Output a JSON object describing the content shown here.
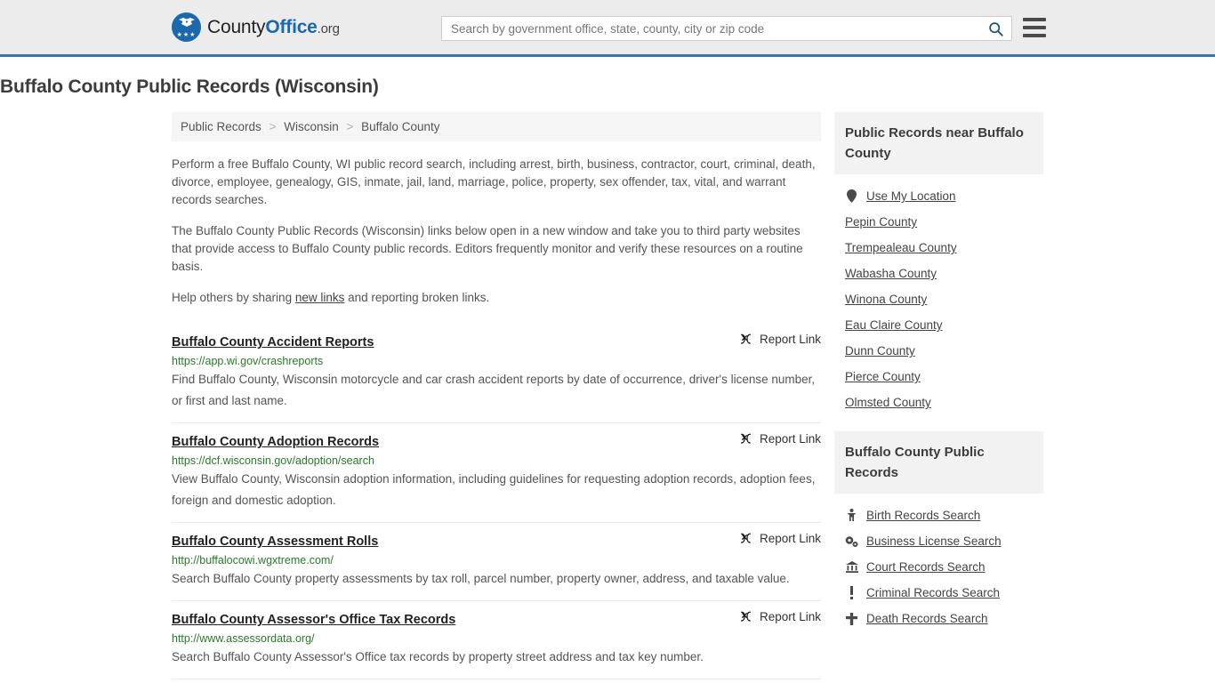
{
  "header": {
    "logo": {
      "prefix": "County",
      "bold": "Office",
      "tld": ".org",
      "icon": "eagle-logo-icon",
      "stars": "★★★"
    },
    "search": {
      "placeholder": "Search by government office, state, county, city or zip code",
      "value": "",
      "button_icon": "search-icon"
    },
    "menu_icon": "hamburger-menu-icon",
    "accent_color": "#3a74a8"
  },
  "page": {
    "title": "Buffalo County Public Records (Wisconsin)"
  },
  "breadcrumb": {
    "items": [
      "Public Records",
      "Wisconsin",
      "Buffalo County"
    ],
    "separator": ">"
  },
  "intro": {
    "p1": "Perform a free Buffalo County, WI public record search, including arrest, birth, business, contractor, court, criminal, death, divorce, employee, genealogy, GIS, inmate, jail, land, marriage, police, property, sex offender, tax, vital, and warrant records searches.",
    "p2": "The Buffalo County Public Records (Wisconsin) links below open in a new window and take you to third party websites that provide access to Buffalo County public records. Editors frequently monitor and verify these resources on a routine basis.",
    "p3_before": "Help others by sharing ",
    "p3_link": "new links",
    "p3_after": " and reporting broken links."
  },
  "report_link_label": "Report Link",
  "report_link_icon": "broken-link-icon",
  "listings": [
    {
      "title": "Buffalo County Accident Reports",
      "url": "https://app.wi.gov/crashreports",
      "description": "Find Buffalo County, Wisconsin motorcycle and car crash accident reports by date of occurrence, driver's license number, or first and last name."
    },
    {
      "title": "Buffalo County Adoption Records",
      "url": "https://dcf.wisconsin.gov/adoption/search",
      "description": "View Buffalo County, Wisconsin adoption information, including guidelines for requesting adoption records, adoption fees, foreign and domestic adoption."
    },
    {
      "title": "Buffalo County Assessment Rolls",
      "url": "http://buffalocowi.wgxtreme.com/",
      "description": "Search Buffalo County property assessments by tax roll, parcel number, property owner, address, and taxable value."
    },
    {
      "title": "Buffalo County Assessor's Office Tax Records",
      "url": "http://www.assessordata.org/",
      "description": "Search Buffalo County Assessor's Office tax records by property street address and tax key number."
    }
  ],
  "sidebar": {
    "panels": [
      {
        "heading": "Public Records near Buffalo County",
        "items": [
          {
            "label": "Use My Location",
            "icon": "map-pin-icon"
          },
          {
            "label": "Pepin County",
            "icon": ""
          },
          {
            "label": "Trempealeau County",
            "icon": ""
          },
          {
            "label": "Wabasha County",
            "icon": ""
          },
          {
            "label": "Winona County",
            "icon": ""
          },
          {
            "label": "Eau Claire County",
            "icon": ""
          },
          {
            "label": "Dunn County",
            "icon": ""
          },
          {
            "label": "Pierce County",
            "icon": ""
          },
          {
            "label": "Olmsted County",
            "icon": ""
          }
        ]
      },
      {
        "heading": "Buffalo County Public Records",
        "items": [
          {
            "label": "Birth Records Search",
            "icon": "child-icon"
          },
          {
            "label": "Business License Search",
            "icon": "cogs-icon"
          },
          {
            "label": "Court Records Search",
            "icon": "bank-icon"
          },
          {
            "label": "Criminal Records Search",
            "icon": "exclamation-icon"
          },
          {
            "label": "Death Records Search",
            "icon": "cross-icon"
          }
        ]
      }
    ]
  }
}
